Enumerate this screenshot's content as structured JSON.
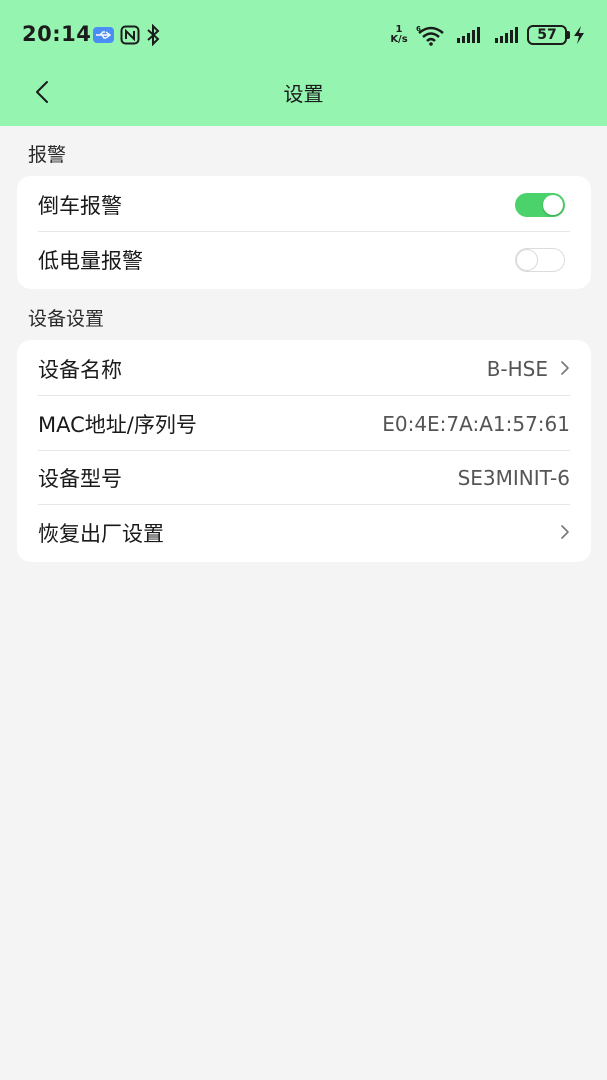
{
  "status_bar": {
    "time": "20:14",
    "net_speed_value": "1",
    "net_speed_unit": "K/s",
    "battery": "57",
    "icons": [
      "usb-icon",
      "nfc-icon",
      "bluetooth-icon",
      "wifi-icon",
      "signal-icon",
      "signal-icon",
      "battery-icon",
      "charging-icon"
    ]
  },
  "header": {
    "title": "设置",
    "back_icon": "chevron-left-icon",
    "background": "#95f5b0"
  },
  "alarm_section": {
    "label": "报警",
    "items": [
      {
        "label": "倒车报警",
        "toggle_on": true
      },
      {
        "label": "低电量报警",
        "toggle_on": false
      }
    ]
  },
  "device_section": {
    "label": "设备设置",
    "items": [
      {
        "label": "设备名称",
        "value": "B-HSE",
        "chevron": true
      },
      {
        "label": "MAC地址/序列号",
        "value": "E0:4E:7A:A1:57:61",
        "chevron": false
      },
      {
        "label": "设备型号",
        "value": "SE3MINIT-6",
        "chevron": false
      },
      {
        "label": "恢复出厂设置",
        "value": "",
        "chevron": true
      }
    ]
  },
  "colors": {
    "accent_green": "#4cd26a",
    "page_background": "#f4f4f4"
  }
}
